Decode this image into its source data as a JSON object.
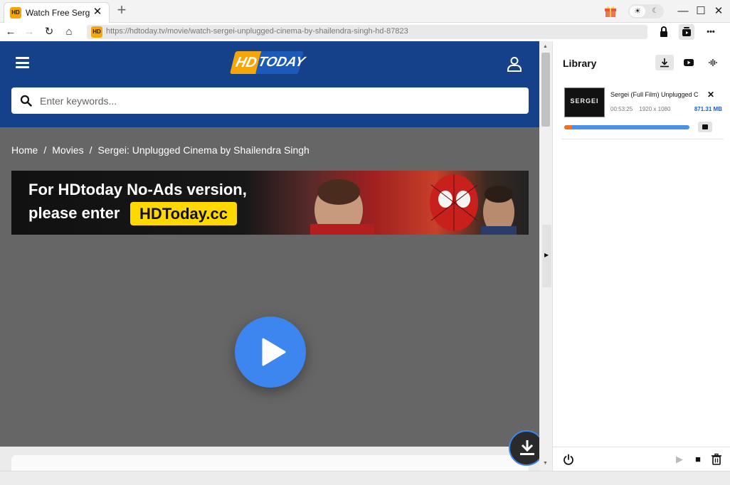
{
  "browser": {
    "tab_title": "Watch Free Sergei: Unplugged Cinema by Shailendra Singh",
    "tab_favicon": "HD",
    "new_tab": "+",
    "url": "https://hdtoday.tv/movie/watch-sergei-unplugged-cinema-by-shailendra-singh-hd-87823",
    "icons": {
      "back": "←",
      "forward": "→",
      "reload": "↻",
      "home": "⌂",
      "close_tab": "✕",
      "minimize": "—",
      "maximize": "☐",
      "close_window": "✕",
      "sun": "☀",
      "moon": "☾",
      "more": "•••"
    }
  },
  "site": {
    "logo_hd": "HD",
    "logo_today": "TODAY",
    "search_placeholder": "Enter keywords...",
    "breadcrumb": [
      "Home",
      "Movies",
      "Sergei: Unplugged Cinema by Shailendra Singh"
    ],
    "breadcrumb_sep": "/",
    "banner": {
      "line1": "For HDtoday No-Ads version,",
      "line2": "please enter",
      "domain": "HDToday.cc"
    }
  },
  "library": {
    "title": "Library",
    "tabs": {
      "download": "⤓",
      "video": "▶",
      "audio": "∿"
    },
    "items": [
      {
        "thumb_text": "SERGEI",
        "title": "Sergei (Full Film)  Unplugged Cinema by Shailendra Singh",
        "duration": "00:53:25",
        "resolution": "1920 x 1080",
        "size": "871.31 MB",
        "progress": 0.06,
        "close": "✕"
      }
    ],
    "footer": {
      "play": "▶",
      "stop": "■",
      "trash": "🗑"
    }
  },
  "colors": {
    "header_blue": "#144189",
    "accent_orange": "#f6a609",
    "play_blue": "#3d86f0",
    "progress_orange": "#f27021",
    "progress_blue": "#4a90e8",
    "size_blue": "#1a5fd0"
  }
}
